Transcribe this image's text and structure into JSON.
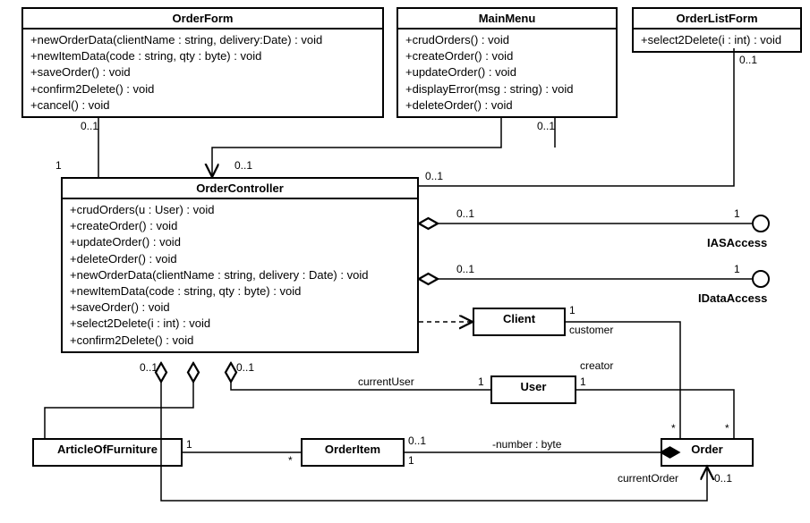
{
  "classes": {
    "OrderForm": {
      "name": "OrderForm",
      "ops": [
        "+newOrderData(clientName : string, delivery:Date) : void",
        "+newItemData(code : string, qty : byte) : void",
        "+saveOrder() : void",
        "+confirm2Delete() : void",
        "+cancel() : void"
      ]
    },
    "MainMenu": {
      "name": "MainMenu",
      "ops": [
        "+crudOrders() : void",
        "+createOrder() : void",
        "+updateOrder() : void",
        "+displayError(msg : string) : void",
        "+deleteOrder() : void"
      ]
    },
    "OrderListForm": {
      "name": "OrderListForm",
      "ops": [
        "+select2Delete(i : int) : void"
      ]
    },
    "OrderController": {
      "name": "OrderController",
      "ops": [
        "+crudOrders(u : User) : void",
        "+createOrder() : void",
        "+updateOrder() : void",
        "+deleteOrder() : void",
        "+newOrderData(clientName : string, delivery : Date) : void",
        "+newItemData(code : string, qty : byte) : void",
        "+saveOrder() : void",
        "+select2Delete(i : int) : void",
        "+confirm2Delete() : void"
      ]
    },
    "Client": {
      "name": "Client",
      "ops": []
    },
    "User": {
      "name": "User",
      "ops": []
    },
    "ArticleOfFurniture": {
      "name": "ArticleOfFurniture",
      "ops": []
    },
    "OrderItem": {
      "name": "OrderItem",
      "ops": []
    },
    "Order": {
      "name": "Order",
      "ops": []
    }
  },
  "interfaces": {
    "IASAccess": "IASAccess",
    "IDataAccess": "IDataAccess"
  },
  "mult": {
    "of_oc_top": "0..1",
    "of_oc_left": "1",
    "mm_oc_top": "0..1",
    "olf_top": "0..1",
    "mm_oc_bottom": "0..1",
    "oc_olf_right": "0..1",
    "oc_ias_left": "0..1",
    "oc_ias_right": "1",
    "oc_ida_left": "0..1",
    "oc_ida_right": "1",
    "client_right": "1",
    "user_right": "1",
    "user_left": "1",
    "order_star1": "*",
    "order_star2": "*",
    "oc_oi_left": "0..1",
    "oc_af_left": "0..1",
    "af_right": "1",
    "oi_left": "*",
    "oi_right_top": "0..1",
    "oi_right_bottom": "1",
    "order_bottom": "0..1"
  },
  "roles": {
    "customer": "customer",
    "creator": "creator",
    "currentUser": "currentUser",
    "currentOrder": "currentOrder",
    "number": "-number : byte"
  }
}
